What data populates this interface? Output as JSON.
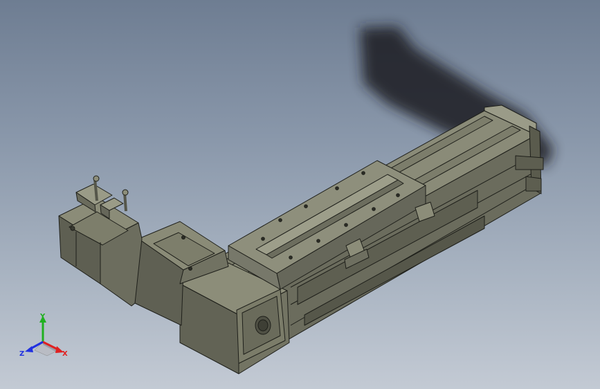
{
  "view": {
    "background_top": "#6e7d92",
    "background_bottom": "#c3cad4",
    "model_color": "#6f7060",
    "edge_color": "#1e1f1a"
  },
  "triad": {
    "x_label": "X",
    "y_label": "Y",
    "z_label": "Z",
    "x_color": "#e02020",
    "y_color": "#20b020",
    "z_color": "#2030e0"
  }
}
